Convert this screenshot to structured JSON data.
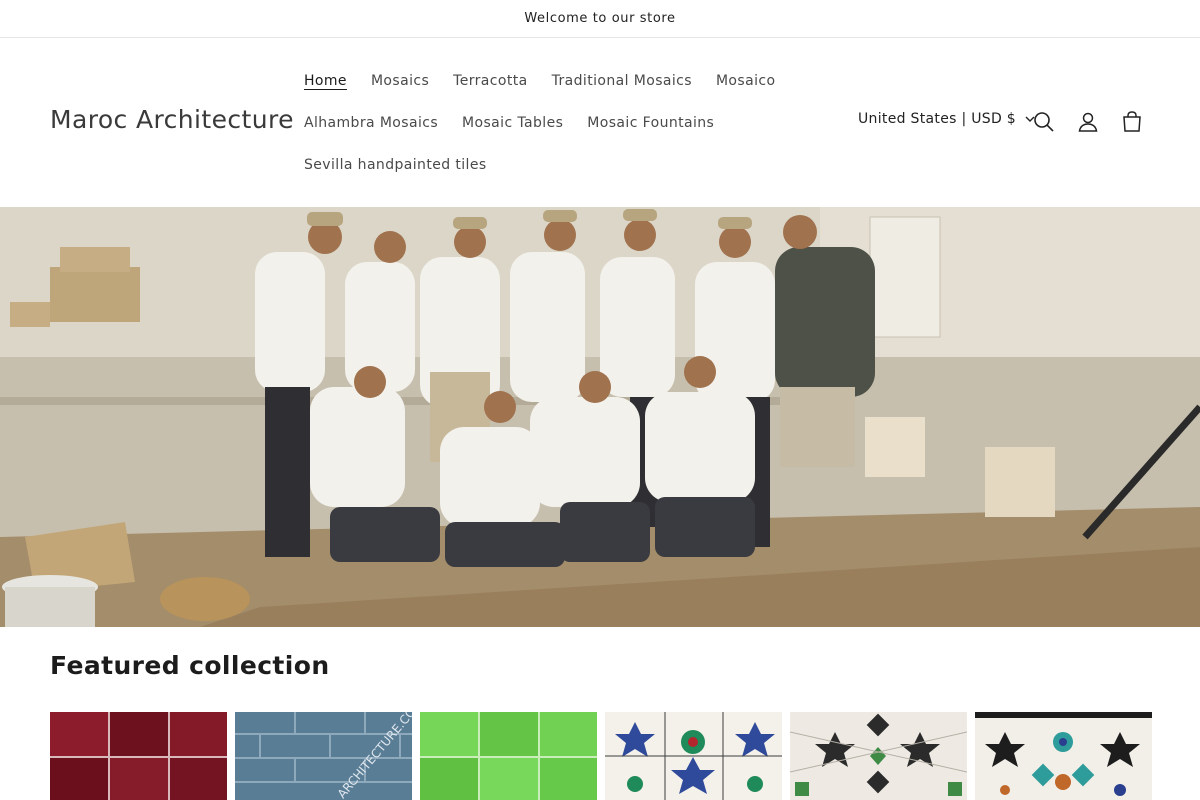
{
  "announcement": {
    "text": "Welcome to our store"
  },
  "header": {
    "logo": "Maroc Architecture",
    "nav": {
      "row1": [
        "Home",
        "Mosaics",
        "Terracotta",
        "Traditional Mosaics",
        "Mosaico"
      ],
      "row2": [
        "Alhambra Mosaics",
        "Mosaic Tables",
        "Mosaic Fountains"
      ],
      "row3": [
        "Sevilla handpainted tiles"
      ]
    },
    "active_nav": "Home",
    "country_selector": "United States | USD $",
    "icons": [
      "search-icon",
      "account-icon",
      "cart-icon"
    ]
  },
  "hero": {
    "image": "team-photo"
  },
  "featured": {
    "title": "Featured collection",
    "products": [
      {
        "color": "#7a1523",
        "pattern": "red-zellige"
      },
      {
        "color": "#5a7d96",
        "pattern": "blue-subway",
        "watermark": "ARCHITECTURE.COM"
      },
      {
        "color": "#6ccf4e",
        "pattern": "green-zellige"
      },
      {
        "color": "#2f4a9a",
        "pattern": "star-mosaic-blue"
      },
      {
        "color": "#2b2b2b",
        "pattern": "star-mosaic-black"
      },
      {
        "color": "#2d9c9a",
        "pattern": "star-mosaic-teal"
      }
    ]
  },
  "colors": {
    "text": "#121212",
    "border": "#e6e6e6",
    "background": "#ffffff"
  }
}
